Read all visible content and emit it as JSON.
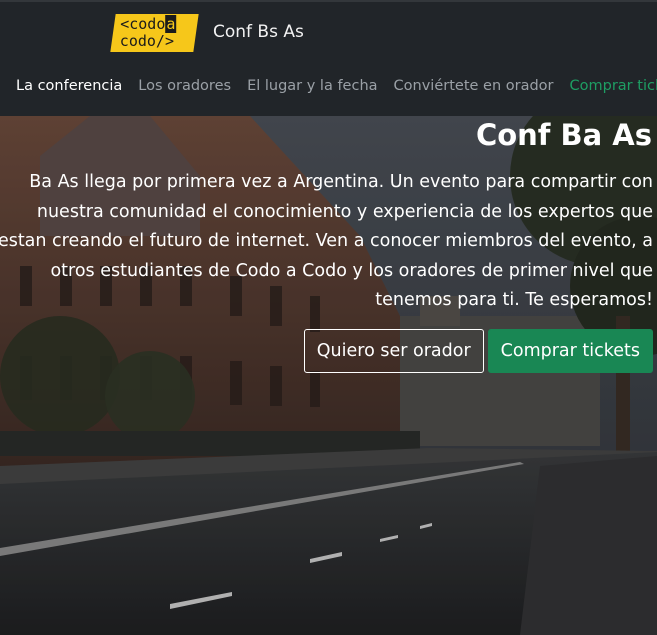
{
  "brand": {
    "logo_line1": "<codo",
    "logo_line1_hl": "a",
    "logo_line2": "codo/>",
    "title": "Conf Bs As"
  },
  "nav": {
    "items": [
      {
        "label": "La conferencia"
      },
      {
        "label": "Los oradores"
      },
      {
        "label": "El lugar y la fecha"
      },
      {
        "label": "Conviértete en orador"
      },
      {
        "label": "Comprar tickets"
      }
    ]
  },
  "hero": {
    "title": "Conf Ba As",
    "description": "Ba As llega por primera vez a Argentina. Un evento para compartir con nuestra comunidad el conocimiento y experiencia de los expertos que estan creando el futuro de internet. Ven a conocer miembros del evento, a otros estudiantes de Codo a Codo y los oradores de primer nivel que tenemos para ti. Te esperamos!",
    "primary_button": "Quiero ser orador",
    "secondary_button": "Comprar tickets"
  },
  "colors": {
    "navbar_bg": "#212529",
    "logo_yellow": "#f6c71a",
    "accent_green": "#198754",
    "nav_link": "#9aa0a6"
  }
}
